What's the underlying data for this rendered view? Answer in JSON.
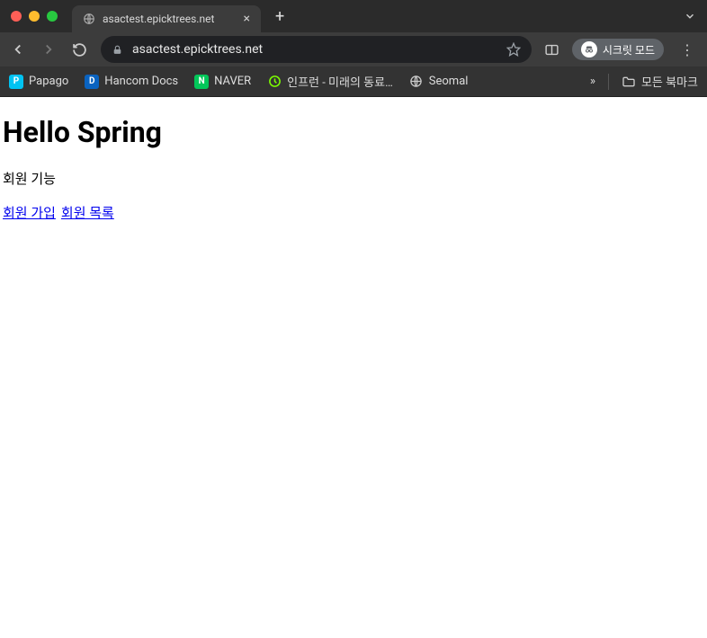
{
  "window": {
    "tab_title": "asactest.epicktrees.net",
    "url_display": "asactest.epicktrees.net",
    "incognito_label": "시크릿 모드"
  },
  "bookmarks": {
    "items": [
      {
        "label": "Papago",
        "icon": "papago"
      },
      {
        "label": "Hancom Docs",
        "icon": "hancom"
      },
      {
        "label": "NAVER",
        "icon": "naver"
      },
      {
        "label": "인프런 - 미래의 동료…",
        "icon": "inflearn"
      },
      {
        "label": "Seomal",
        "icon": "seomal"
      }
    ],
    "more_label": "»",
    "all_label": "모든 북마크"
  },
  "page": {
    "heading": "Hello Spring",
    "subtitle": "회원 기능",
    "links": {
      "signup": "회원 가입",
      "list": "회원 목록"
    }
  }
}
